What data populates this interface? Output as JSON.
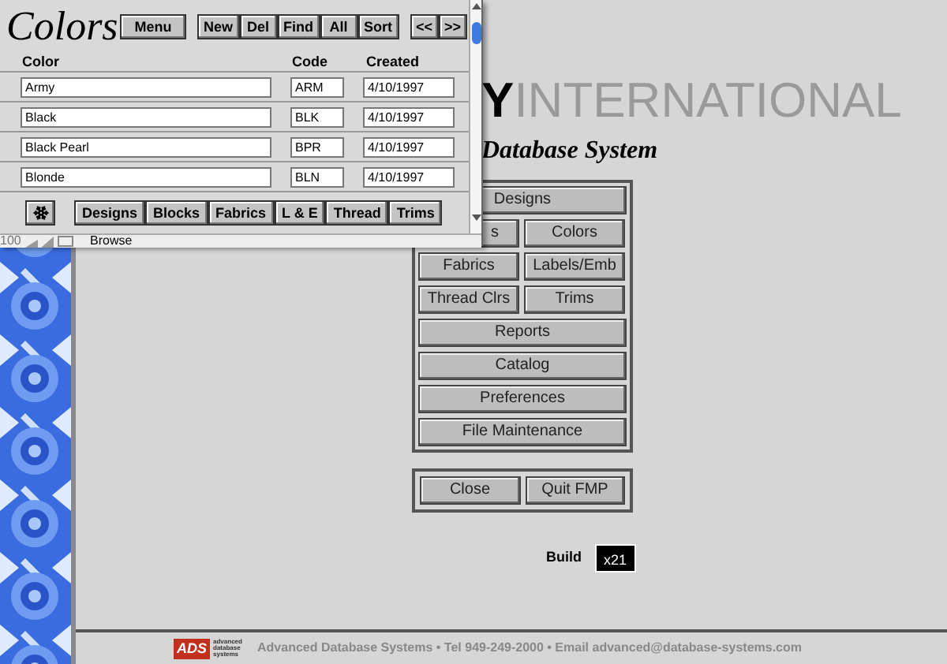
{
  "colors_window": {
    "title": "Colors",
    "menu_button": "Menu",
    "record_buttons": [
      "New",
      "Del",
      "Find",
      "All",
      "Sort"
    ],
    "nav_buttons": [
      "<<",
      ">>"
    ],
    "columns": [
      "Color",
      "Code",
      "Created"
    ],
    "rows": [
      {
        "name": "Army",
        "code": "ARM",
        "created": "4/10/1997"
      },
      {
        "name": "Black",
        "code": "BLK",
        "created": "4/10/1997"
      },
      {
        "name": "Black Pearl",
        "code": "BPR",
        "created": "4/10/1997"
      },
      {
        "name": "Blonde",
        "code": "BLN",
        "created": "4/10/1997"
      }
    ],
    "tabs": [
      "Designs",
      "Blocks",
      "Fabrics",
      "L & E",
      "Thread",
      "Trims"
    ],
    "status_bar": {
      "zoom": "100",
      "mode": "Browse"
    }
  },
  "logo": {
    "mark": "Y",
    "text": "INTERNATIONAL"
  },
  "subtitle": "Database System",
  "menu": [
    {
      "label": "Designs",
      "kind": "wide"
    },
    {
      "label": "s",
      "kind": "half"
    },
    {
      "label": "Colors",
      "kind": "half"
    },
    {
      "label": "Fabrics",
      "kind": "half"
    },
    {
      "label": "Labels/Emb",
      "kind": "half"
    },
    {
      "label": "Thread Clrs",
      "kind": "half"
    },
    {
      "label": "Trims",
      "kind": "half"
    },
    {
      "label": "Reports",
      "kind": "wide"
    },
    {
      "label": "Catalog",
      "kind": "wide"
    },
    {
      "label": "Preferences",
      "kind": "wide"
    },
    {
      "label": "File Maintenance",
      "kind": "wide"
    }
  ],
  "exit_buttons": [
    "Close",
    "Quit FMP"
  ],
  "build": {
    "label": "Build",
    "value": "x21"
  },
  "footer": {
    "logo_mark": "ADS",
    "logo_text": "advanced database systems",
    "text": "Advanced Database Systems • Tel 949-249-2000 • Email advanced@database-systems.com"
  }
}
